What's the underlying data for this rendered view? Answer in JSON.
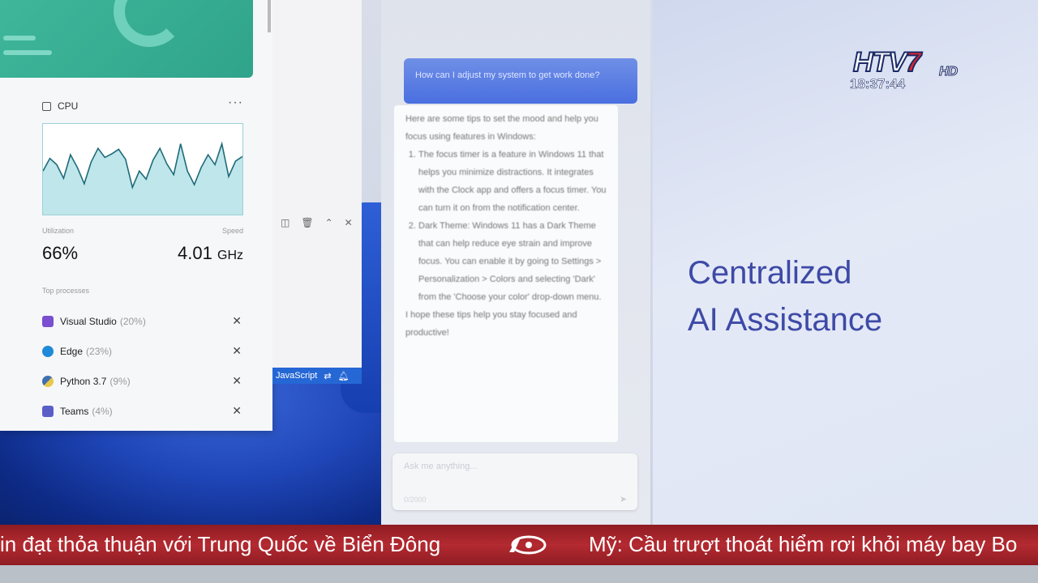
{
  "cpu_widget": {
    "title": "CPU",
    "more": "···",
    "utilization_label": "Utilization",
    "utilization": "66%",
    "speed_label": "Speed",
    "speed_value": "4.01",
    "speed_unit": "GHz",
    "processes_title": "Top processes",
    "processes": [
      {
        "name": "Visual Studio",
        "pct": "(20%)",
        "color": "#7a4fd0"
      },
      {
        "name": "Edge",
        "pct": "(23%)",
        "color": "#1f8ad8"
      },
      {
        "name": "Python 3.7",
        "pct": "(9%)",
        "color": "#3f6fb0"
      },
      {
        "name": "Teams",
        "pct": "(4%)",
        "color": "#5a5fc8"
      }
    ],
    "close": "✕"
  },
  "editor": {
    "status_lang": "JavaScript"
  },
  "copilot": {
    "question": "How can I adjust my system to get work done?",
    "answer_intro": "Here are some tips to set the mood and help you focus using features in Windows:",
    "tips": [
      "The focus timer is a feature in Windows 11 that helps you minimize distractions. It integrates with the Clock app and offers a focus timer. You can turn it on from the notification center.",
      "Dark Theme: Windows 11 has a Dark Theme that can help reduce eye strain and improve focus. You can enable it by going to Settings > Personalization > Colors and selecting 'Dark' from the 'Choose your color' drop-down menu."
    ],
    "answer_outro": "I hope these tips help you stay focused and productive!",
    "input_placeholder": "Ask me anything...",
    "input_counter": "0/2000"
  },
  "headline": {
    "line1": "Centralized",
    "line2": "AI Assistance"
  },
  "channel": {
    "name_htv": "HTV",
    "name_7": "7",
    "hd": "HD",
    "clock": "18:37:44"
  },
  "ticker": {
    "item1": "in đạt thỏa thuận với Trung Quốc về Biển Đông",
    "item2": "Mỹ: Cầu trượt thoát hiểm rơi khỏi máy bay Bo"
  },
  "chart_data": {
    "type": "line",
    "title": "CPU",
    "xlabel": "",
    "ylabel": "",
    "ylim": [
      0,
      100
    ],
    "x": [
      0,
      1,
      2,
      3,
      4,
      5,
      6,
      7,
      8,
      9,
      10,
      11,
      12,
      13,
      14,
      15,
      16,
      17,
      18,
      19,
      20,
      21,
      22,
      23,
      24,
      25,
      26,
      27,
      28,
      29
    ],
    "series": [
      {
        "name": "",
        "values": [
          48,
          62,
          55,
          40,
          66,
          52,
          34,
          58,
          73,
          63,
          67,
          72,
          61,
          30,
          48,
          39,
          60,
          73,
          56,
          44,
          78,
          48,
          33,
          52,
          66,
          55,
          78,
          42,
          59,
          64
        ]
      }
    ]
  }
}
